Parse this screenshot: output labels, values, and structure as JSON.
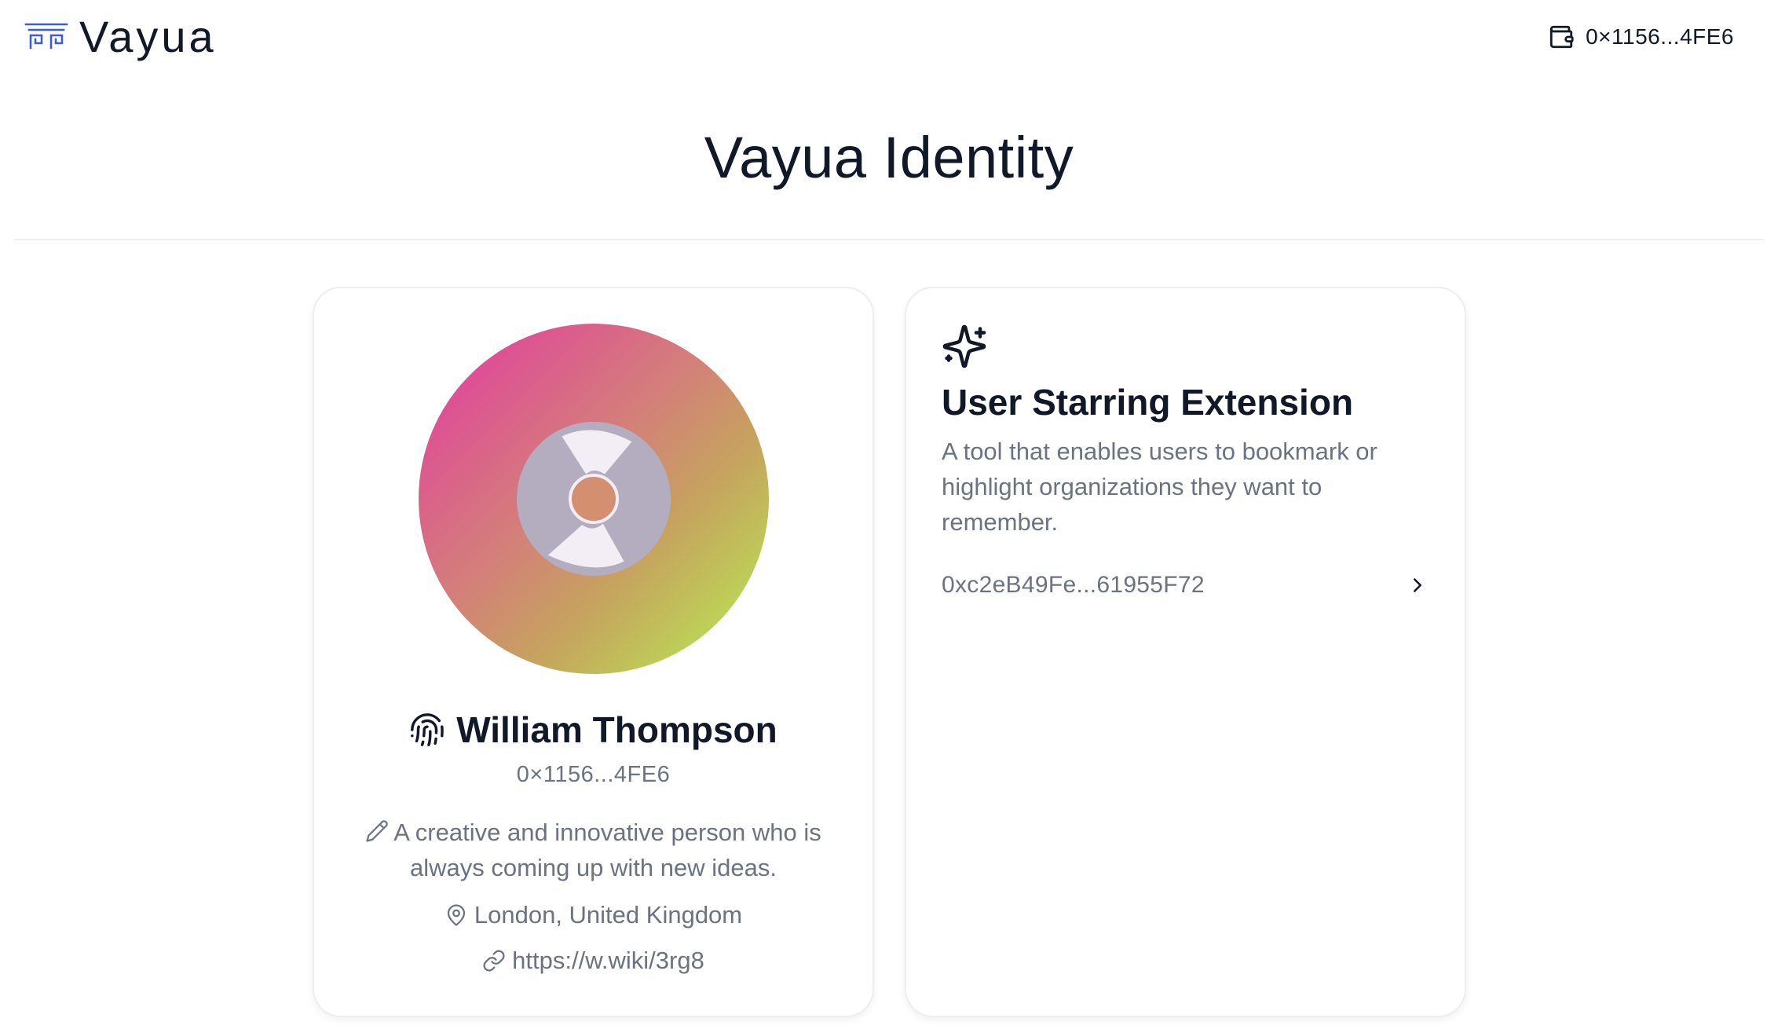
{
  "header": {
    "logo_text": "Vayua",
    "wallet_address": "0×1156...4FE6"
  },
  "page": {
    "title": "Vayua Identity"
  },
  "profile": {
    "name": "William Thompson",
    "address": "0×1156...4FE6",
    "bio": "A creative and innovative person who is always coming up with new ideas.",
    "location": "London, United Kingdom",
    "link": "https://w.wiki/3rg8",
    "avatar_colors": [
      "#e0459a",
      "#d38179",
      "#c6a35e",
      "#bbdf55"
    ]
  },
  "extension": {
    "title": "User Starring Extension",
    "description": "A tool that enables users to bookmark or highlight organizations they want to remember.",
    "address": "0xc2eB49Fe...61955F72"
  },
  "colors": {
    "text_primary": "#111827",
    "text_secondary": "#6b7280",
    "logo_accent": "#3b5bdb",
    "border": "#eceef1"
  },
  "icons": {
    "logo": "vayua-logo-icon",
    "wallet": "wallet-icon",
    "fingerprint": "fingerprint-icon",
    "bio": "pencil-icon",
    "location": "map-pin-icon",
    "link": "link-icon",
    "extension": "sparkles-icon",
    "open": "chevron-right-icon"
  }
}
